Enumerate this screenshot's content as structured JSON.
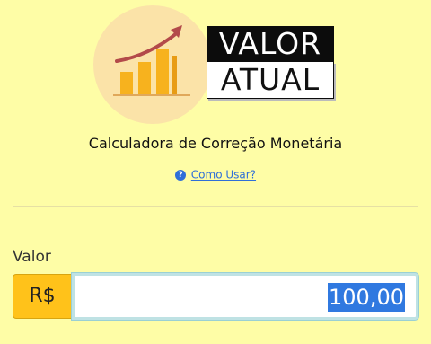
{
  "logo": {
    "word1": "VALOR",
    "word2": "ATUAL",
    "colors": {
      "circle": "#fbe3a8",
      "bars": "#f7b21e",
      "arrow": "#b34a4a"
    }
  },
  "title": "Calculadora de Correção Monetária",
  "help": {
    "icon": "?",
    "label": "Como Usar?"
  },
  "form": {
    "value_label": "Valor",
    "currency_prefix": "R$",
    "value": "100,00"
  }
}
